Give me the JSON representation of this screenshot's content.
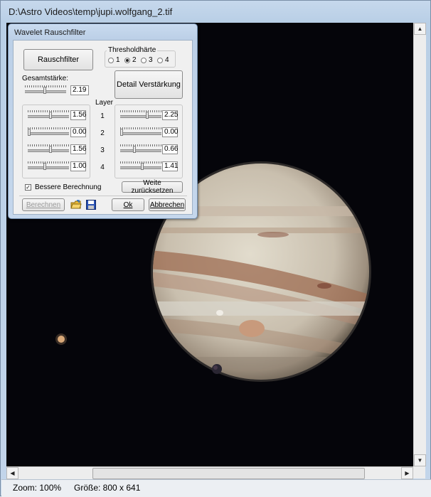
{
  "window": {
    "title": "D:\\Astro Videos\\temp\\jupi.wolfgang_2.tif"
  },
  "status": {
    "zoom": "Zoom: 100%",
    "size": "Größe: 800 x 641"
  },
  "dialog": {
    "title": "Wavelet Rauschfilter",
    "rauschfilter_button": "Rauschfilter",
    "threshold_label": "Thresholdhärte",
    "threshold_options": [
      "1",
      "2",
      "3",
      "4"
    ],
    "threshold_selected": "2",
    "gesamtstaerke_label": "Gesamtstärke:",
    "gesamtstaerke_value": "2.19",
    "detail_button": "Detail Verstärkung",
    "layer_label": "Layer",
    "layers": [
      {
        "num": "1",
        "left": "1.56",
        "right": "2.25"
      },
      {
        "num": "2",
        "left": "0.00",
        "right": "0.00"
      },
      {
        "num": "3",
        "left": "1.56",
        "right": "0.66"
      },
      {
        "num": "4",
        "left": "1.00",
        "right": "1.41"
      }
    ],
    "bessere_label": "Bessere Berechnung",
    "bessere_checked": true,
    "reset_button": "Weite zurücksetzen",
    "berechnen_button": "Berechnen",
    "ok_button": "Ok",
    "abbrechen_button": "Abbrechen"
  }
}
